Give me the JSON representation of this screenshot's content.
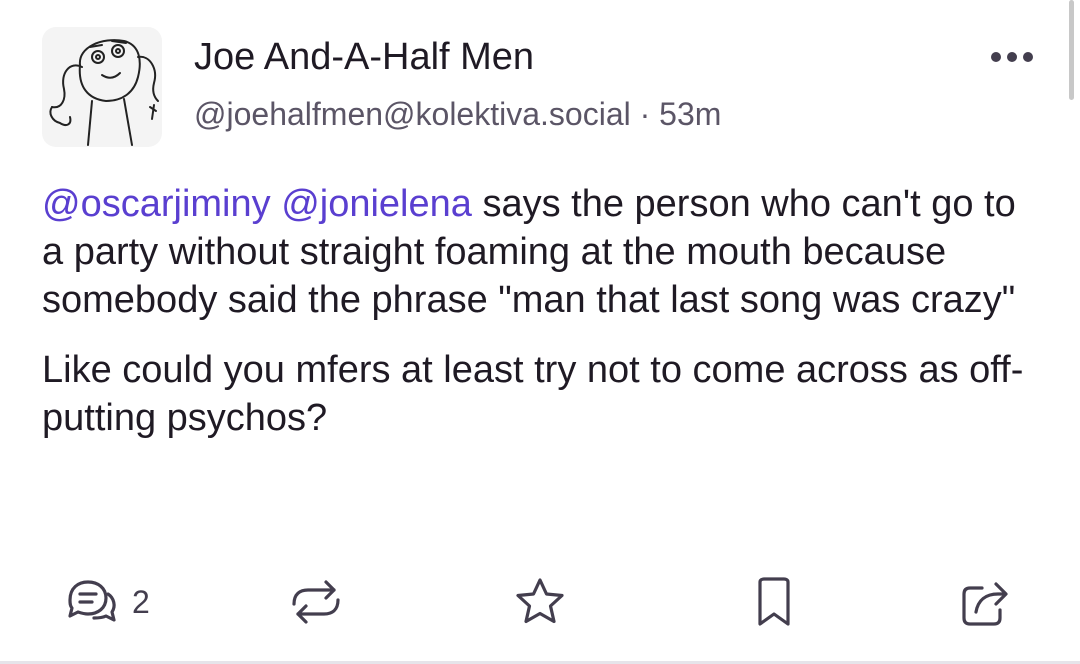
{
  "post": {
    "display_name": "Joe And-A-Half Men",
    "handle": "@joehalfmen@kolektiva.social",
    "separator": " · ",
    "time_ago": "53m",
    "mentions": [
      "@oscarjiminy",
      "@jonielena"
    ],
    "paragraph1_rest": " says the person who can't go to a party without straight foaming at the mouth because somebody said the phrase \"man that last song was crazy\"",
    "paragraph2": "Like could you mfers at least try not to come across as off-putting psychos?"
  },
  "actions": {
    "reply_count": "2",
    "icons": [
      "reply-icon",
      "boost-icon",
      "favourite-icon",
      "bookmark-icon",
      "share-icon"
    ]
  },
  "colors": {
    "mention": "#5a3fd0",
    "text": "#1f1a24",
    "secondary": "#5b5566",
    "icon": "#433e4e"
  }
}
